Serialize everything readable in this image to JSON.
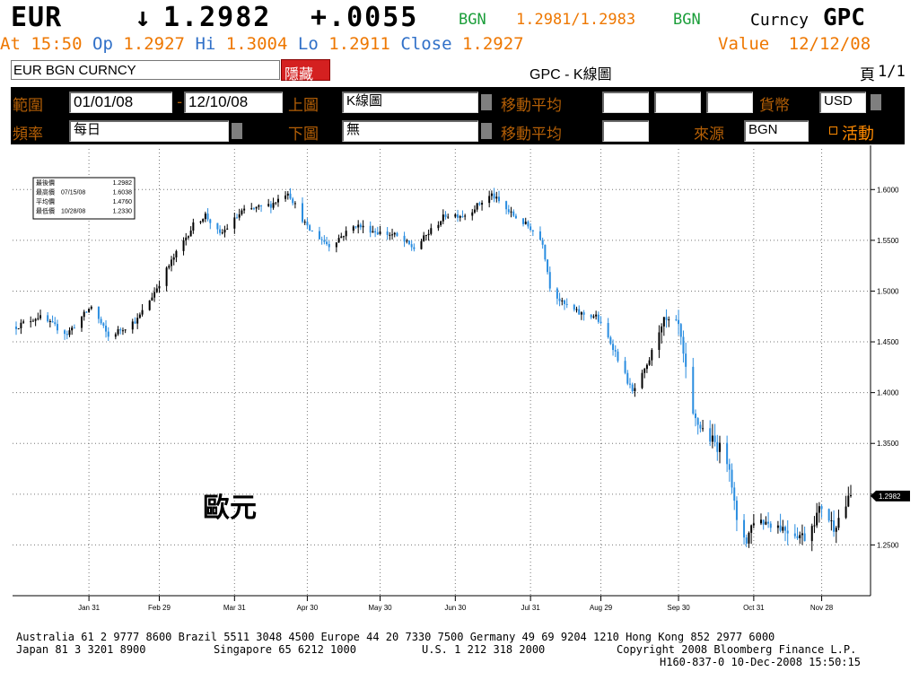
{
  "colors": {
    "orange": "#ee7700",
    "green": "#1b9e3a",
    "blue_label": "#3070c8",
    "up_bar": "#000000",
    "down_bar": "#2a8de0",
    "red_tab": "#d42020",
    "label": "#b45f06"
  },
  "header": {
    "ticker": "EUR",
    "arrow": "↓",
    "last": "1.2982",
    "change": "+.0055",
    "bgn1": "BGN",
    "bid_ask": "1.2981/1.2983",
    "bgn2": "BGN",
    "curncy": "Curncy",
    "gpc": "GPC",
    "at_label": "At",
    "time": "15:50",
    "op_label": "Op",
    "op": "1.2927",
    "hi_label": "Hi",
    "hi": "1.3004",
    "lo_label": "Lo",
    "lo": "1.2911",
    "close_label": "Close",
    "close": "1.2927",
    "value_label": "Value",
    "value_date": "12/12/08"
  },
  "titlebar": {
    "security": "EUR BGN CURNCY",
    "hide_button": "隱藏",
    "page_title": "GPC - K線圖",
    "page_label": "頁",
    "page_num": "1/1"
  },
  "form": {
    "range_label": "範圍",
    "start_date": "01/01/08",
    "dash": "-",
    "end_date": "12/10/08",
    "upper_label": "上圖",
    "upper_value": "K線圖",
    "ma_label_1": "移動平均",
    "currency_label": "貨幣",
    "currency_value": "USD",
    "freq_label": "頻率",
    "freq_value": "每日",
    "lower_label": "下圖",
    "lower_value": "無",
    "ma_label_2": "移動平均",
    "source_label": "來源",
    "source_value": "BGN",
    "live_button": "活動"
  },
  "chart_data": {
    "type": "candlestick",
    "y_ticks": [
      "1.6000",
      "1.5500",
      "1.5000",
      "1.4500",
      "1.4000",
      "1.3500",
      "1.3000",
      "1.2500"
    ],
    "x_ticks": [
      "Jan 31",
      "Feb 29",
      "Mar 31",
      "Apr 30",
      "May 30",
      "Jun 30",
      "Jul 31",
      "Aug 29",
      "Sep 30",
      "Oct 31",
      "Nov 28"
    ],
    "ylim": [
      1.2,
      1.64
    ],
    "last_price_tag": "1.2982",
    "annotation": "歐元",
    "legend_box": {
      "rows": [
        {
          "label": "最後價",
          "date": "",
          "value": "1.2982"
        },
        {
          "label": "最高價",
          "date": "07/15/08",
          "value": "1.6038"
        },
        {
          "label": "平均價",
          "date": "",
          "value": "1.4760"
        },
        {
          "label": "最低價",
          "date": "10/28/08",
          "value": "1.2330"
        }
      ]
    },
    "series_anchors": [
      {
        "date": "01/01/08",
        "value": 1.465
      },
      {
        "date": "01/10/08",
        "value": 1.475
      },
      {
        "date": "01/22/08",
        "value": 1.458
      },
      {
        "date": "02/01/08",
        "value": 1.485
      },
      {
        "date": "02/08/08",
        "value": 1.455
      },
      {
        "date": "02/20/08",
        "value": 1.472
      },
      {
        "date": "02/26/08",
        "value": 1.495
      },
      {
        "date": "03/04/08",
        "value": 1.525
      },
      {
        "date": "03/14/08",
        "value": 1.565
      },
      {
        "date": "03/19/08",
        "value": 1.575
      },
      {
        "date": "03/25/08",
        "value": 1.555
      },
      {
        "date": "04/03/08",
        "value": 1.578
      },
      {
        "date": "04/15/08",
        "value": 1.585
      },
      {
        "date": "04/22/08",
        "value": 1.598
      },
      {
        "date": "04/30/08",
        "value": 1.562
      },
      {
        "date": "05/09/08",
        "value": 1.545
      },
      {
        "date": "05/20/08",
        "value": 1.565
      },
      {
        "date": "05/29/08",
        "value": 1.558
      },
      {
        "date": "06/05/08",
        "value": 1.555
      },
      {
        "date": "06/13/08",
        "value": 1.542
      },
      {
        "date": "06/26/08",
        "value": 1.575
      },
      {
        "date": "07/04/08",
        "value": 1.575
      },
      {
        "date": "07/15/08",
        "value": 1.595
      },
      {
        "date": "07/22/08",
        "value": 1.578
      },
      {
        "date": "07/31/08",
        "value": 1.562
      },
      {
        "date": "08/05/08",
        "value": 1.548
      },
      {
        "date": "08/08/08",
        "value": 1.505
      },
      {
        "date": "08/13/08",
        "value": 1.488
      },
      {
        "date": "08/20/08",
        "value": 1.478
      },
      {
        "date": "08/27/08",
        "value": 1.475
      },
      {
        "date": "09/03/08",
        "value": 1.445
      },
      {
        "date": "09/11/08",
        "value": 1.4
      },
      {
        "date": "09/17/08",
        "value": 1.425
      },
      {
        "date": "09/23/08",
        "value": 1.47
      },
      {
        "date": "09/30/08",
        "value": 1.465
      },
      {
        "date": "10/06/08",
        "value": 1.375
      },
      {
        "date": "10/13/08",
        "value": 1.355
      },
      {
        "date": "10/17/08",
        "value": 1.345
      },
      {
        "date": "10/21/08",
        "value": 1.33
      },
      {
        "date": "10/24/08",
        "value": 1.27
      },
      {
        "date": "10/28/08",
        "value": 1.255
      },
      {
        "date": "10/31/08",
        "value": 1.275
      },
      {
        "date": "11/07/08",
        "value": 1.272
      },
      {
        "date": "11/14/08",
        "value": 1.265
      },
      {
        "date": "11/21/08",
        "value": 1.258
      },
      {
        "date": "11/28/08",
        "value": 1.288
      },
      {
        "date": "12/03/08",
        "value": 1.268
      },
      {
        "date": "12/10/08",
        "value": 1.298
      }
    ]
  },
  "footer": {
    "line1": "Australia 61 2 9777 8600 Brazil 5511 3048 4500 Europe 44 20 7330 7500 Germany 49 69 9204 1210 Hong Kong 852 2977 6000",
    "line2_left": "Japan 81 3 3201 8900",
    "line2_mid1": "Singapore 65 6212 1000",
    "line2_mid2": "U.S. 1 212 318 2000",
    "line2_right": "Copyright 2008 Bloomberg Finance L.P.",
    "line3": "H160-837-0 10-Dec-2008 15:50:15"
  }
}
